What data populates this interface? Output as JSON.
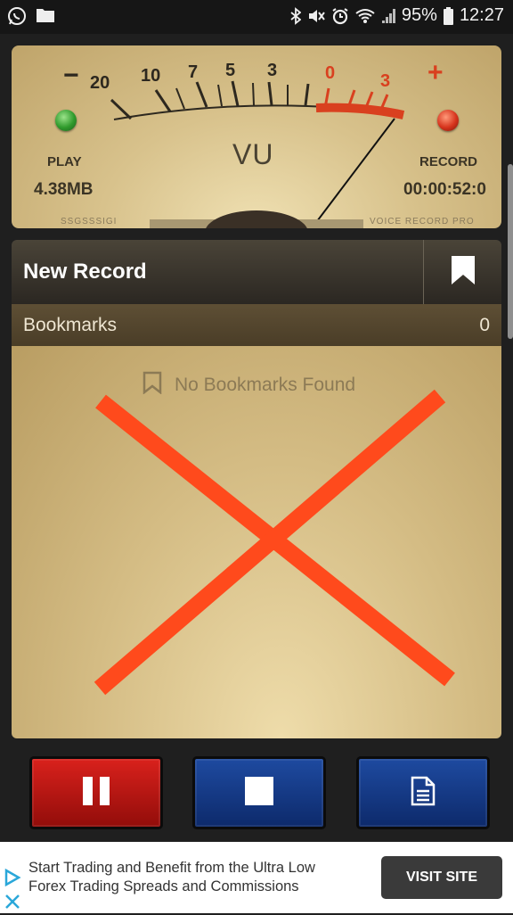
{
  "status_bar": {
    "battery_percent": "95%",
    "time": "12:27",
    "left_icons": [
      "whatsapp-icon",
      "folder-icon"
    ],
    "right_icons": [
      "bluetooth-icon",
      "mute-icon",
      "alarm-icon",
      "wifi-icon",
      "signal-icon",
      "battery-icon"
    ]
  },
  "vu_meter": {
    "minus_sign": "−",
    "plus_sign": "+",
    "scale": [
      "20",
      "10",
      "7",
      "5",
      "3",
      "0",
      "3"
    ],
    "title": "VU",
    "play_label": "PLAY",
    "file_size": "4.38MB",
    "record_label": "RECORD",
    "elapsed_time": "00:00:52:0",
    "brand_left": "SSGSSSIGI",
    "brand_right": "VOICE RECORD PRO",
    "colors": {
      "play_led": "#2f9a2c",
      "record_led": "#d6331c",
      "red_zone": "#d9401f"
    }
  },
  "record": {
    "title": "New Record",
    "bookmark_button_icon": "bookmark-icon"
  },
  "bookmarks": {
    "label": "Bookmarks",
    "count": "0",
    "empty_message": "No Bookmarks Found"
  },
  "controls": {
    "pause_icon": "pause-icon",
    "stop_icon": "stop-icon",
    "notes_icon": "document-icon",
    "colors": {
      "pause": "#c0180f",
      "stop": "#143d8c",
      "notes": "#143d8c"
    }
  },
  "overlay": {
    "color": "#ff4a1c",
    "icon": "cross-mark"
  },
  "ad": {
    "line1": "Start Trading and Benefit from the Ultra Low",
    "line2": "Forex Trading Spreads and Commissions",
    "button": "VISIT SITE"
  }
}
